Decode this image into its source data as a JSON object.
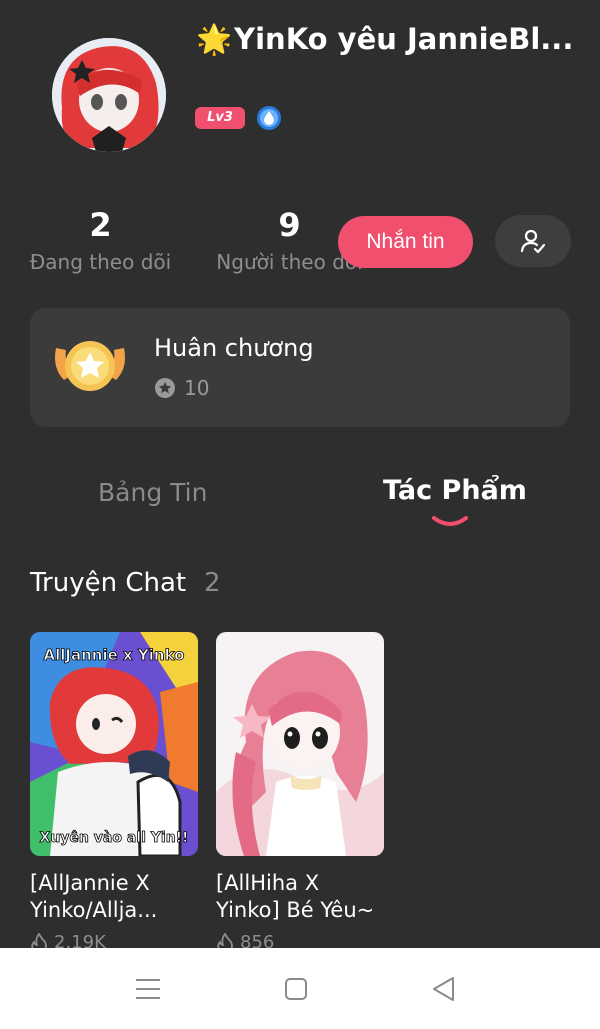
{
  "profile": {
    "star_emoji": "🌟",
    "username": "YinKo yêu JannieBl...",
    "level": "Lv3",
    "verify_icon": "shield-drop-icon"
  },
  "stats": {
    "following_count": "2",
    "following_label": "Đang theo dõi",
    "followers_count": "9",
    "followers_label": "Người theo dõi"
  },
  "actions": {
    "message_label": "Nhắn tin",
    "follow_icon": "user-check-icon"
  },
  "medal": {
    "title": "Huân chương",
    "count": "10"
  },
  "tabs": [
    {
      "label": "Bảng Tin",
      "active": false
    },
    {
      "label": "Tác Phẩm",
      "active": true
    }
  ],
  "section": {
    "title": "Truyện Chat",
    "count": "2"
  },
  "stories": [
    {
      "title": "[AllJannie X Yinko/Allja...",
      "views": "2.19K",
      "cover_text_top": "AllJannie x Yinko",
      "cover_text_bottom": "Xuyên vào all Yin!!"
    },
    {
      "title": "[AllHiha X Yinko] Bé Yêu~",
      "views": "856"
    }
  ],
  "colors": {
    "accent": "#f0506e",
    "background": "#2e2e2e",
    "card": "#3b3b3b"
  }
}
